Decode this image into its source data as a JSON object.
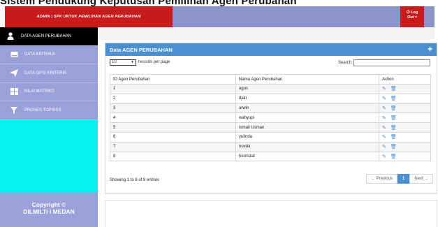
{
  "page_title": "Sistem Pendukung Keputusan Pemilihan Agen Perubahan",
  "header": {
    "brand": "ADMIN | SPK UNTUK PEMILIHAN AGEN PERUBAHAN",
    "logout_line1": "Log",
    "logout_line2": "Out"
  },
  "sidebar": {
    "items": [
      {
        "label": "DATA AGEN PERUBAHAN",
        "icon": "user-icon"
      },
      {
        "label": "DATA KRITERIA",
        "icon": "drive-icon"
      },
      {
        "label": "DATA OPSI KRITERIA",
        "icon": "paper-plane-icon"
      },
      {
        "label": "NILAI MATRIKS",
        "icon": "grid-icon"
      },
      {
        "label": "PROSES TOPSISS",
        "icon": "filter-icon"
      }
    ],
    "footer_line1": "Copyright ©",
    "footer_line2": "DILMILTI I MEDAN"
  },
  "panel": {
    "title": "Data AGEN PERUBAHAN",
    "length_value": "10",
    "length_text": "records per page",
    "search_label": "Search:",
    "search_value": "",
    "columns": [
      "ID Agen Perubahan",
      "Nama Agen Perubahan",
      "Action"
    ],
    "rows": [
      {
        "id": "1",
        "name": "agus"
      },
      {
        "id": "2",
        "name": "djati"
      },
      {
        "id": "3",
        "name": "arwin"
      },
      {
        "id": "4",
        "name": "wahyupi"
      },
      {
        "id": "5",
        "name": "Ismail Usman"
      },
      {
        "id": "6",
        "name": "yulinda"
      },
      {
        "id": "7",
        "name": "novda"
      },
      {
        "id": "8",
        "name": "hermizal"
      }
    ],
    "info": "Showing 1 to 8 of 8 entries",
    "pager": {
      "prev": "← Previous",
      "page": "1",
      "next": "Next →"
    }
  },
  "colors": {
    "accent": "#4a8fd0",
    "brand": "#c81b1b",
    "sidebar": "#9aa0d9",
    "sidebar_fill": "#06f1f1"
  }
}
